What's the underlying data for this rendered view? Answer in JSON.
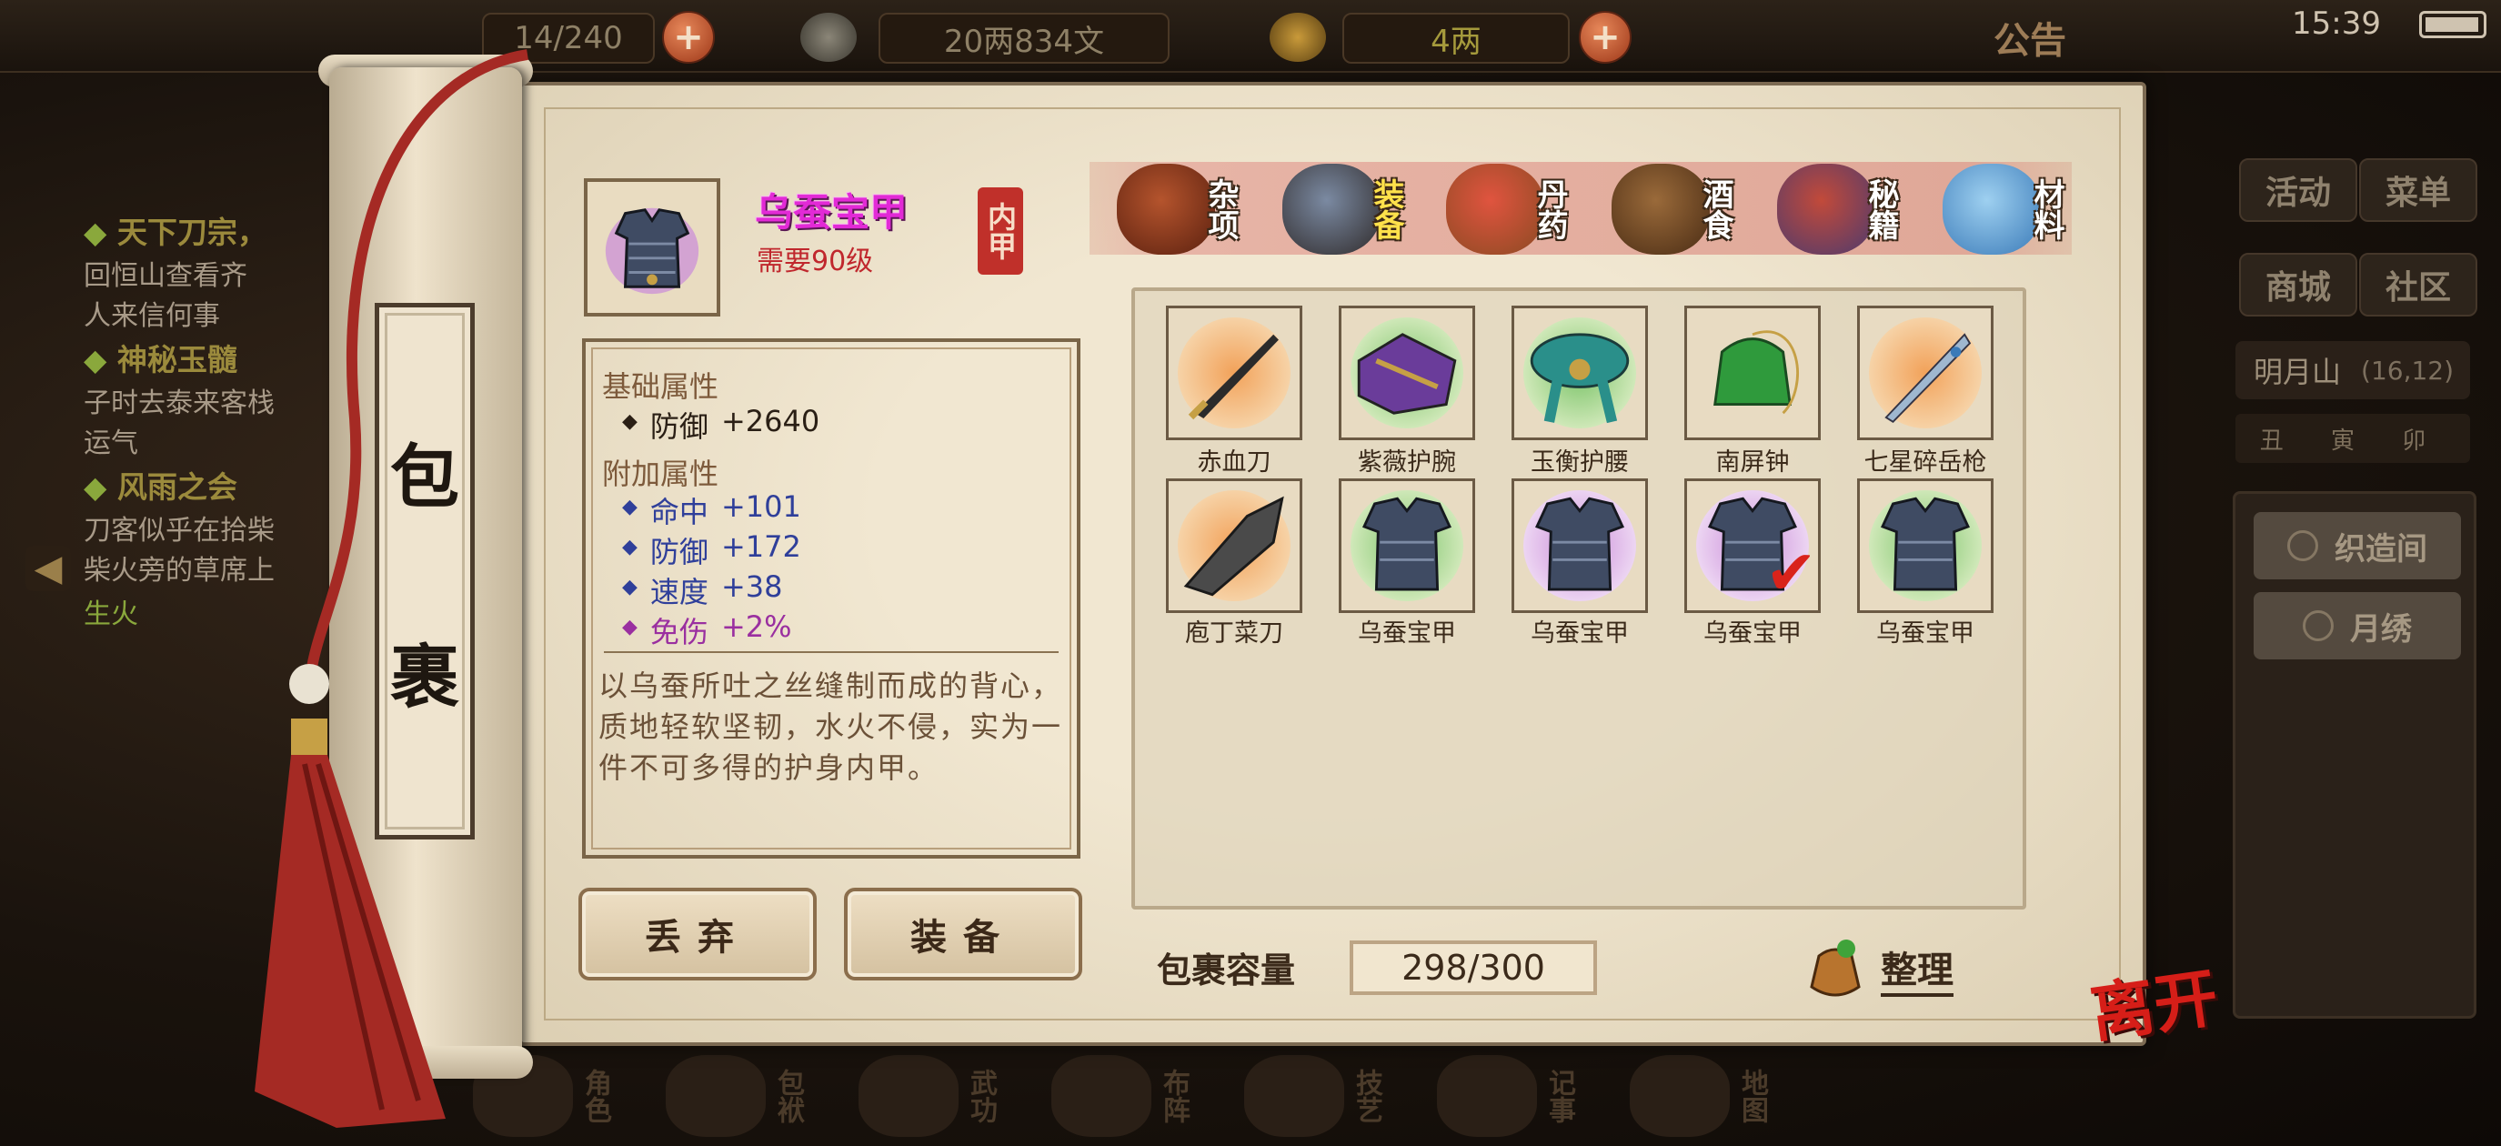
{
  "hud": {
    "bag_count": "14/240",
    "silver": "20两834文",
    "gold": "4两",
    "announcement": "公告",
    "time": "15:39",
    "plus_icon": "plus-icon"
  },
  "quests": [
    {
      "title": "天下刀宗，",
      "desc": [
        "回恒山查看齐",
        "人来信何事"
      ]
    },
    {
      "title": "神秘玉髓",
      "desc": [
        "子时去泰来客栈",
        "运气"
      ]
    },
    {
      "title": "风雨之会",
      "desc": [
        "刀客似乎在拾柴",
        "柴火旁的草席上"
      ],
      "highlight": "生火"
    }
  ],
  "right_menu": {
    "buttons": [
      "活动",
      "菜单",
      "商城",
      "社区"
    ],
    "location": "明月山",
    "coords": "(16,12)",
    "time_labels": "丑 寅 卯",
    "side_buttons": [
      "织造间",
      "月绣"
    ]
  },
  "bottom_nav": [
    "角色",
    "包袱",
    "武功",
    "布阵",
    "技艺",
    "记事",
    "地图"
  ],
  "bag": {
    "scroll_title": [
      "包",
      "裹"
    ],
    "selected": {
      "name": "乌蚕宝甲",
      "level_req": "需要90级",
      "slot_tag": "内甲",
      "base_title": "基础属性",
      "base": [
        {
          "name": "防御",
          "value": "+2640"
        }
      ],
      "extra_title": "附加属性",
      "extra": [
        {
          "name": "命中",
          "value": "+101",
          "color": "#2f3f9a"
        },
        {
          "name": "防御",
          "value": "+172",
          "color": "#2f3f9a"
        },
        {
          "name": "速度",
          "value": "+38",
          "color": "#2f3f9a"
        },
        {
          "name": "免伤",
          "value": "+2%",
          "color": "#9a2fa0"
        }
      ],
      "description": "以乌蚕所吐之丝缝制而成的背心，质地轻软坚韧，水火不侵，实为一件不可多得的护身内甲。"
    },
    "buttons": {
      "discard": "丢弃",
      "equip": "装备"
    },
    "tabs": [
      {
        "label": "杂项",
        "icon": "jar-icon"
      },
      {
        "label": "装备",
        "icon": "equipment-bundle-icon",
        "active": true
      },
      {
        "label": "丹药",
        "icon": "pills-icon"
      },
      {
        "label": "酒食",
        "icon": "wine-food-icon"
      },
      {
        "label": "秘籍",
        "icon": "books-icon"
      },
      {
        "label": "材料",
        "icon": "crystal-icon"
      }
    ],
    "items": [
      {
        "name": "赤血刀",
        "icon": "dark-blade-icon",
        "halo": "#f2a25a"
      },
      {
        "name": "紫薇护腕",
        "icon": "bracer-icon",
        "halo": "#7cc46a"
      },
      {
        "name": "玉衡护腰",
        "icon": "belt-icon",
        "halo": "#7cc46a"
      },
      {
        "name": "南屏钟",
        "icon": "bell-icon",
        "halo": "#e8dbc2"
      },
      {
        "name": "七星碎岳枪",
        "icon": "spear-icon",
        "halo": "#f2a25a"
      },
      {
        "name": "庖丁菜刀",
        "icon": "cleaver-icon",
        "halo": "#f2a25a"
      },
      {
        "name": "乌蚕宝甲",
        "icon": "armor-icon",
        "halo": "#7cc46a"
      },
      {
        "name": "乌蚕宝甲",
        "icon": "armor-icon",
        "halo": "#c98ad8"
      },
      {
        "name": "乌蚕宝甲",
        "icon": "armor-icon",
        "halo": "#c98ad8",
        "equipped": true
      },
      {
        "name": "乌蚕宝甲",
        "icon": "armor-icon",
        "halo": "#7cc46a"
      }
    ],
    "capacity_label": "包裹容量",
    "capacity": "298/300",
    "sort_label": "整理",
    "leave_label": "离开"
  }
}
